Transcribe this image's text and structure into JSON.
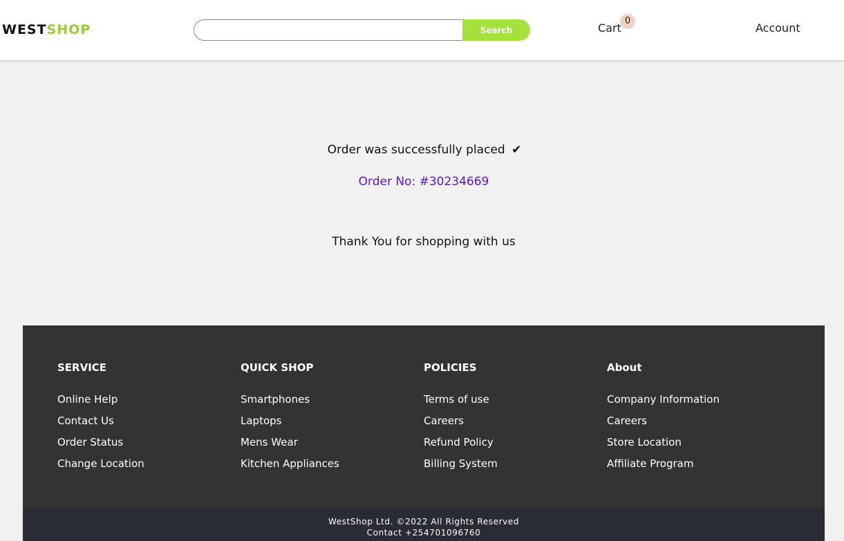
{
  "header": {
    "logo_part1": "WEST",
    "logo_part2": "SHOP",
    "search_value": "",
    "search_button": "Search",
    "cart_label": "Cart",
    "cart_count": "0",
    "account_label": "Account"
  },
  "main": {
    "success_message": "Order was successfully placed",
    "check_glyph": "✔",
    "order_number": "Order No: #30234669",
    "thank_you": "Thank You for shopping with us"
  },
  "footer": {
    "columns": [
      {
        "title": "SERVICE",
        "links": [
          "Online Help",
          "Contact Us",
          "Order Status",
          "Change Location"
        ]
      },
      {
        "title": "QUICK SHOP",
        "links": [
          "Smartphones",
          "Laptops",
          "Mens Wear",
          "Kitchen Appliances"
        ]
      },
      {
        "title": "POLICIES",
        "links": [
          "Terms of use",
          "Careers",
          "Refund Policy",
          "Billing System"
        ]
      },
      {
        "title": "About",
        "links": [
          "Company Information",
          "Careers",
          "Store Location",
          "Affiliate Program"
        ]
      }
    ],
    "copyright": "WestShop Ltd. ©2022 All Rights Reserved",
    "contact": "Contact +254701096760"
  },
  "colors": {
    "brand_accent": "#9acd32",
    "search_button_bg": "#a6e23e",
    "order_number": "#5b15d8",
    "footer_bg": "#333333",
    "bottom_bar_bg": "#292c34",
    "cart_badge_bg": "#f1d2c0"
  }
}
